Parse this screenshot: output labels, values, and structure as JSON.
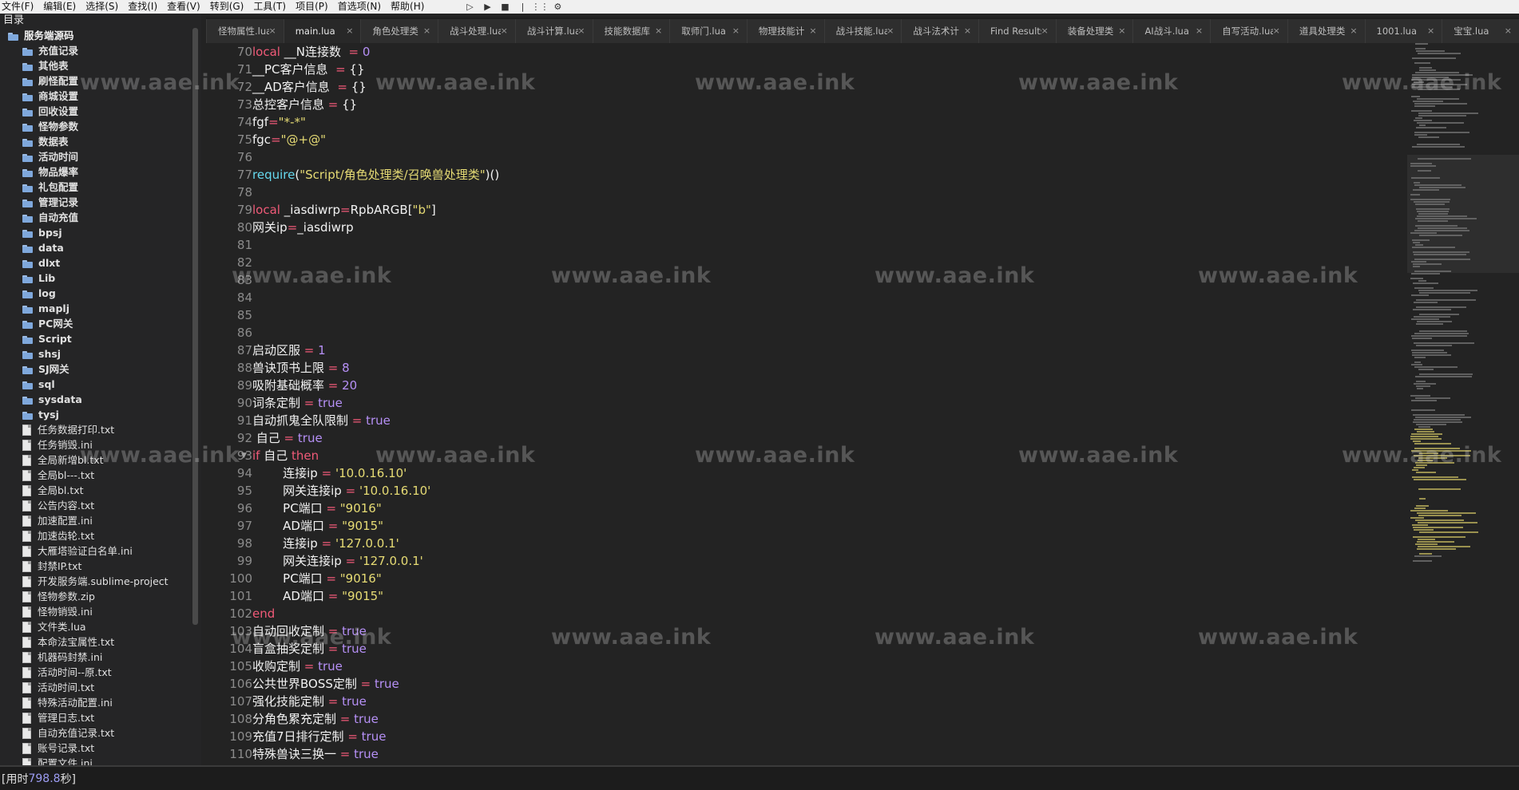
{
  "menu": [
    "文件(F)",
    "编辑(E)",
    "选择(S)",
    "查找(I)",
    "查看(V)",
    "转到(G)",
    "工具(T)",
    "项目(P)",
    "首选项(N)",
    "帮助(H)"
  ],
  "toolbar_icons": [
    "play-icon",
    "run-icon",
    "stop-icon",
    "separator-icon",
    "build-icon",
    "settings-icon"
  ],
  "sidebar": {
    "title": "目录",
    "root": "服务端源码",
    "folders": [
      "充值记录",
      "其他表",
      "刷怪配置",
      "商城设置",
      "回收设置",
      "怪物参数",
      "数据表",
      "活动时间",
      "物品爆率",
      "礼包配置",
      "管理记录",
      "自动充值",
      "bpsj",
      "data",
      "dlxt",
      "Lib",
      "log",
      "maplj",
      "PC网关",
      "Script",
      "shsj",
      "SJ网关",
      "sql",
      "sysdata",
      "tysj"
    ],
    "files": [
      "任务数据打印.txt",
      "任务销毁.ini",
      "全局新增bl.txt",
      "全局bl---.txt",
      "全局bl.txt",
      "公告内容.txt",
      "加速配置.ini",
      "加速齿轮.txt",
      "大雁塔验证白名单.ini",
      "封禁IP.txt",
      "开发服务端.sublime-project",
      "怪物参数.zip",
      "怪物销毁.ini",
      "文件类.lua",
      "本命法宝属性.txt",
      "机器码封禁.ini",
      "活动时间--原.txt",
      "活动时间.txt",
      "特殊活动配置.ini",
      "管理日志.txt",
      "自动充值记录.txt",
      "账号记录.txt",
      "配置文件.ini"
    ]
  },
  "tabs": [
    {
      "label": "怪物属性.lua",
      "active": false
    },
    {
      "label": "main.lua",
      "active": true
    },
    {
      "label": "角色处理类",
      "active": false
    },
    {
      "label": "战斗处理.lua",
      "active": false
    },
    {
      "label": "战斗计算.lua",
      "active": false
    },
    {
      "label": "技能数据库",
      "active": false
    },
    {
      "label": "取师门.lua",
      "active": false
    },
    {
      "label": "物理技能计",
      "active": false
    },
    {
      "label": "战斗技能.lua",
      "active": false
    },
    {
      "label": "战斗法术计",
      "active": false
    },
    {
      "label": "Find Results",
      "active": false
    },
    {
      "label": "装备处理类",
      "active": false
    },
    {
      "label": "AI战斗.lua",
      "active": false
    },
    {
      "label": "自写活动.lua",
      "active": false
    },
    {
      "label": "道具处理类",
      "active": false
    },
    {
      "label": "1001.lua",
      "active": false
    },
    {
      "label": "宝宝.lua",
      "active": false
    }
  ],
  "code": [
    {
      "n": "70",
      "t": [
        [
          "kw",
          "local"
        ],
        [
          "id",
          " __N连接数 "
        ],
        [
          "op",
          " = "
        ],
        [
          "num",
          "0"
        ]
      ]
    },
    {
      "n": "71",
      "t": [
        [
          "id",
          "__PC客户信息 "
        ],
        [
          "op",
          " = "
        ],
        [
          "id",
          "{}"
        ]
      ]
    },
    {
      "n": "72",
      "t": [
        [
          "id",
          "__AD客户信息 "
        ],
        [
          "op",
          " = "
        ],
        [
          "id",
          "{}"
        ]
      ]
    },
    {
      "n": "73",
      "t": [
        [
          "id",
          "总控客户信息 "
        ],
        [
          "op",
          "= "
        ],
        [
          "id",
          "{}"
        ]
      ]
    },
    {
      "n": "74",
      "t": [
        [
          "id",
          "fgf"
        ],
        [
          "op",
          "="
        ],
        [
          "str",
          "\"*-*\""
        ]
      ]
    },
    {
      "n": "75",
      "t": [
        [
          "id",
          "fgc"
        ],
        [
          "op",
          "="
        ],
        [
          "str",
          "\"@+@\""
        ]
      ]
    },
    {
      "n": "76",
      "t": []
    },
    {
      "n": "77",
      "t": [
        [
          "fn",
          "require"
        ],
        [
          "id",
          "("
        ],
        [
          "str",
          "\"Script/角色处理类/召唤兽处理类\""
        ],
        [
          "id",
          ")()"
        ]
      ]
    },
    {
      "n": "78",
      "t": []
    },
    {
      "n": "79",
      "t": [
        [
          "kw",
          "local"
        ],
        [
          "id",
          " _iasdiwrp"
        ],
        [
          "op",
          "="
        ],
        [
          "id",
          "RpbARGB["
        ],
        [
          "str",
          "\"b\""
        ],
        [
          "id",
          "]"
        ]
      ]
    },
    {
      "n": "80",
      "t": [
        [
          "id",
          "网关ip"
        ],
        [
          "op",
          "="
        ],
        [
          "id",
          "_iasdiwrp"
        ]
      ]
    },
    {
      "n": "81",
      "t": []
    },
    {
      "n": "82",
      "t": []
    },
    {
      "n": "83",
      "t": []
    },
    {
      "n": "84",
      "t": []
    },
    {
      "n": "85",
      "t": []
    },
    {
      "n": "86",
      "t": []
    },
    {
      "n": "87",
      "t": [
        [
          "id",
          "启动区服 "
        ],
        [
          "op",
          "= "
        ],
        [
          "num",
          "1"
        ]
      ]
    },
    {
      "n": "88",
      "t": [
        [
          "id",
          "兽诀顶书上限 "
        ],
        [
          "op",
          "= "
        ],
        [
          "num",
          "8"
        ]
      ]
    },
    {
      "n": "89",
      "t": [
        [
          "id",
          "吸附基础概率 "
        ],
        [
          "op",
          "= "
        ],
        [
          "num",
          "20"
        ]
      ]
    },
    {
      "n": "90",
      "t": [
        [
          "id",
          "词条定制 "
        ],
        [
          "op",
          "= "
        ],
        [
          "bool",
          "true"
        ]
      ]
    },
    {
      "n": "91",
      "t": [
        [
          "id",
          "自动抓鬼全队限制 "
        ],
        [
          "op",
          "= "
        ],
        [
          "bool",
          "true"
        ]
      ]
    },
    {
      "n": "92",
      "t": [
        [
          "id",
          " 自己 "
        ],
        [
          "op",
          "= "
        ],
        [
          "bool",
          "true"
        ]
      ]
    },
    {
      "n": "93",
      "fold": true,
      "t": [
        [
          "kw",
          "if"
        ],
        [
          "id",
          " 自己 "
        ],
        [
          "kw",
          "then"
        ]
      ]
    },
    {
      "n": "94",
      "t": [
        [
          "id",
          "        连接ip "
        ],
        [
          "op",
          "= "
        ],
        [
          "str",
          "'10.0.16.10'"
        ]
      ]
    },
    {
      "n": "95",
      "t": [
        [
          "id",
          "        网关连接ip "
        ],
        [
          "op",
          "= "
        ],
        [
          "str",
          "'10.0.16.10'"
        ]
      ]
    },
    {
      "n": "96",
      "t": [
        [
          "id",
          "        PC端口 "
        ],
        [
          "op",
          "= "
        ],
        [
          "str",
          "\"9016\""
        ]
      ]
    },
    {
      "n": "97",
      "t": [
        [
          "id",
          "        AD端口 "
        ],
        [
          "op",
          "= "
        ],
        [
          "str",
          "\"9015\""
        ]
      ]
    },
    {
      "n": "98",
      "t": [
        [
          "id",
          "        连接ip "
        ],
        [
          "op",
          "= "
        ],
        [
          "str",
          "'127.0.0.1'"
        ]
      ]
    },
    {
      "n": "99",
      "t": [
        [
          "id",
          "        网关连接ip "
        ],
        [
          "op",
          "= "
        ],
        [
          "str",
          "'127.0.0.1'"
        ]
      ]
    },
    {
      "n": "100",
      "t": [
        [
          "id",
          "        PC端口 "
        ],
        [
          "op",
          "= "
        ],
        [
          "str",
          "\"9016\""
        ]
      ]
    },
    {
      "n": "101",
      "t": [
        [
          "id",
          "        AD端口 "
        ],
        [
          "op",
          "= "
        ],
        [
          "str",
          "\"9015\""
        ]
      ]
    },
    {
      "n": "102",
      "t": [
        [
          "kw",
          "end"
        ]
      ]
    },
    {
      "n": "103",
      "t": [
        [
          "id",
          "自动回收定制 "
        ],
        [
          "op",
          "= "
        ],
        [
          "bool",
          "true"
        ]
      ]
    },
    {
      "n": "104",
      "t": [
        [
          "id",
          "盲盒抽奖定制 "
        ],
        [
          "op",
          "= "
        ],
        [
          "bool",
          "true"
        ]
      ]
    },
    {
      "n": "105",
      "t": [
        [
          "id",
          "收购定制 "
        ],
        [
          "op",
          "= "
        ],
        [
          "bool",
          "true"
        ]
      ]
    },
    {
      "n": "106",
      "t": [
        [
          "id",
          "公共世界BOSS定制 "
        ],
        [
          "op",
          "= "
        ],
        [
          "bool",
          "true"
        ]
      ]
    },
    {
      "n": "107",
      "t": [
        [
          "id",
          "强化技能定制 "
        ],
        [
          "op",
          "= "
        ],
        [
          "bool",
          "true"
        ]
      ]
    },
    {
      "n": "108",
      "t": [
        [
          "id",
          "分角色累充定制 "
        ],
        [
          "op",
          "= "
        ],
        [
          "bool",
          "true"
        ]
      ]
    },
    {
      "n": "109",
      "t": [
        [
          "id",
          "充值7日排行定制 "
        ],
        [
          "op",
          "= "
        ],
        [
          "bool",
          "true"
        ]
      ]
    },
    {
      "n": "110",
      "t": [
        [
          "id",
          "特殊兽诀三换一 "
        ],
        [
          "op",
          "= "
        ],
        [
          "bool",
          "true"
        ]
      ]
    }
  ],
  "watermark": "www.aae.ink",
  "status": {
    "label": "[用时 ",
    "value": "798.8",
    "unit": " 秒]"
  },
  "colors": {
    "keyword": "#f05a78",
    "number": "#b690f6",
    "string": "#e6db74",
    "function": "#66d9ef",
    "text": "#f2f2f2",
    "background": "#232323"
  }
}
